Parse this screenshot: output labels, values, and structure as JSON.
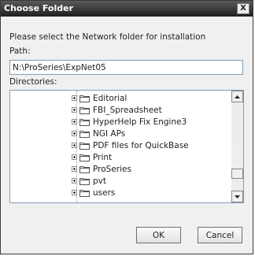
{
  "window": {
    "title": "Choose Folder",
    "close_glyph": "X"
  },
  "prompt": "Please select the Network folder for installation",
  "path": {
    "label": "Path:",
    "value": "N:\\ProSeries\\ExpNet05"
  },
  "directories": {
    "label": "Directories:",
    "items": [
      {
        "label": "Editorial"
      },
      {
        "label": "FBI_Spreadsheet"
      },
      {
        "label": "HyperHelp Fix Engine3"
      },
      {
        "label": "NGI APs"
      },
      {
        "label": "PDF files for QuickBase"
      },
      {
        "label": "Print"
      },
      {
        "label": "ProSeries"
      },
      {
        "label": "pvt"
      },
      {
        "label": "users"
      }
    ],
    "scroll_fraction": 0.85
  },
  "buttons": {
    "ok": "OK",
    "cancel": "Cancel"
  }
}
